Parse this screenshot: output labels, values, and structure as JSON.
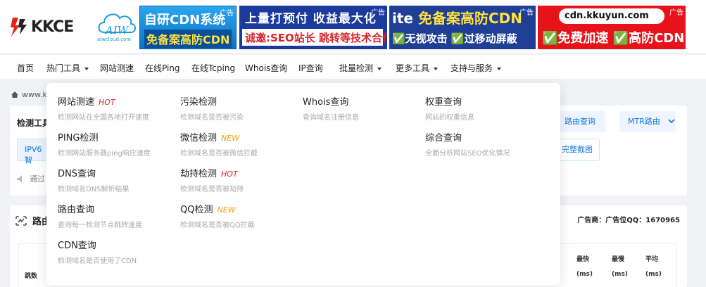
{
  "logo": {
    "kkce": "KKCE",
    "aiw_title": "AIW",
    "aiw_sub": "aiwcloud.com"
  },
  "ads": [
    {
      "tag": "广告",
      "line1": "自研CDN系统",
      "line2": "免备案高防CDN"
    },
    {
      "tag": "广告",
      "line1": "上量打预付 收益最大化",
      "line2": "诚邀:SEO站长 跳转等技术合作"
    },
    {
      "tag": "广告",
      "line1_a": "ite",
      "line1_b": "免备案高防CDN",
      "line2": "✅无视攻击 ✅过移动屏蔽"
    },
    {
      "tag": "广告",
      "line1": "cdn.kkuyun.com",
      "line2": "✅免费加速 ✅高防CDN"
    }
  ],
  "nav": {
    "items": [
      "首页",
      "热门工具",
      "网站测速",
      "在线Ping",
      "在线Tcping",
      "Whois查询",
      "IP查询",
      "批量检测",
      "更多工具",
      "支持与服务"
    ]
  },
  "breadcrumb": "www.k",
  "card1": {
    "title": "检测工具",
    "ipv6": "IPV6 智",
    "notice": "通过",
    "route_button": "路由查询",
    "mtr_select": "MTR路由",
    "screenshot_button": "完整截图"
  },
  "card2": {
    "title": "路由",
    "ad_owner": "广告商：广告位QQ：1670965",
    "headers": {
      "hop": "跳数",
      "best": "最快",
      "worst": "最慢",
      "avg": "平均",
      "unit": "(ms)"
    }
  },
  "menu": {
    "columns": [
      [
        {
          "title": "网站测速",
          "badge": "HOT",
          "badge_type": "hot",
          "desc": "检测网站在全国各地打开速度"
        },
        {
          "title": "PING检测",
          "badge": "",
          "badge_type": "",
          "desc": "检测网站服务器ping响应速度"
        },
        {
          "title": "DNS查询",
          "badge": "",
          "badge_type": "",
          "desc": "检测域名DNS解析结果"
        },
        {
          "title": "路由查询",
          "badge": "",
          "badge_type": "",
          "desc": "查询每一检测节点跳转速度"
        },
        {
          "title": "CDN查询",
          "badge": "",
          "badge_type": "",
          "desc": "检测域名是否使用了CDN"
        }
      ],
      [
        {
          "title": "污染检测",
          "badge": "",
          "badge_type": "",
          "desc": "检测域名是否被污染"
        },
        {
          "title": "微信检测",
          "badge": "NEW",
          "badge_type": "new",
          "desc": "检测域名是否被微信拦截"
        },
        {
          "title": "劫持检测",
          "badge": "HOT",
          "badge_type": "hot",
          "desc": "检测域名是否被劫持"
        },
        {
          "title": "QQ检测",
          "badge": "NEW",
          "badge_type": "new",
          "desc": "检测域名是否被QQ拦截"
        }
      ],
      [
        {
          "title": "Whois查询",
          "badge": "",
          "badge_type": "",
          "desc": "查询域名注册信息"
        }
      ],
      [
        {
          "title": "权重查询",
          "badge": "",
          "badge_type": "",
          "desc": "网站的权重信息"
        },
        {
          "title": "综合查询",
          "badge": "",
          "badge_type": "",
          "desc": "全面分析网站SEO优化情况"
        }
      ]
    ]
  },
  "colors": {
    "accent": "#1677d8",
    "hot": "#e0251b",
    "new": "#f39c12",
    "brand_red": "#e8131a"
  }
}
